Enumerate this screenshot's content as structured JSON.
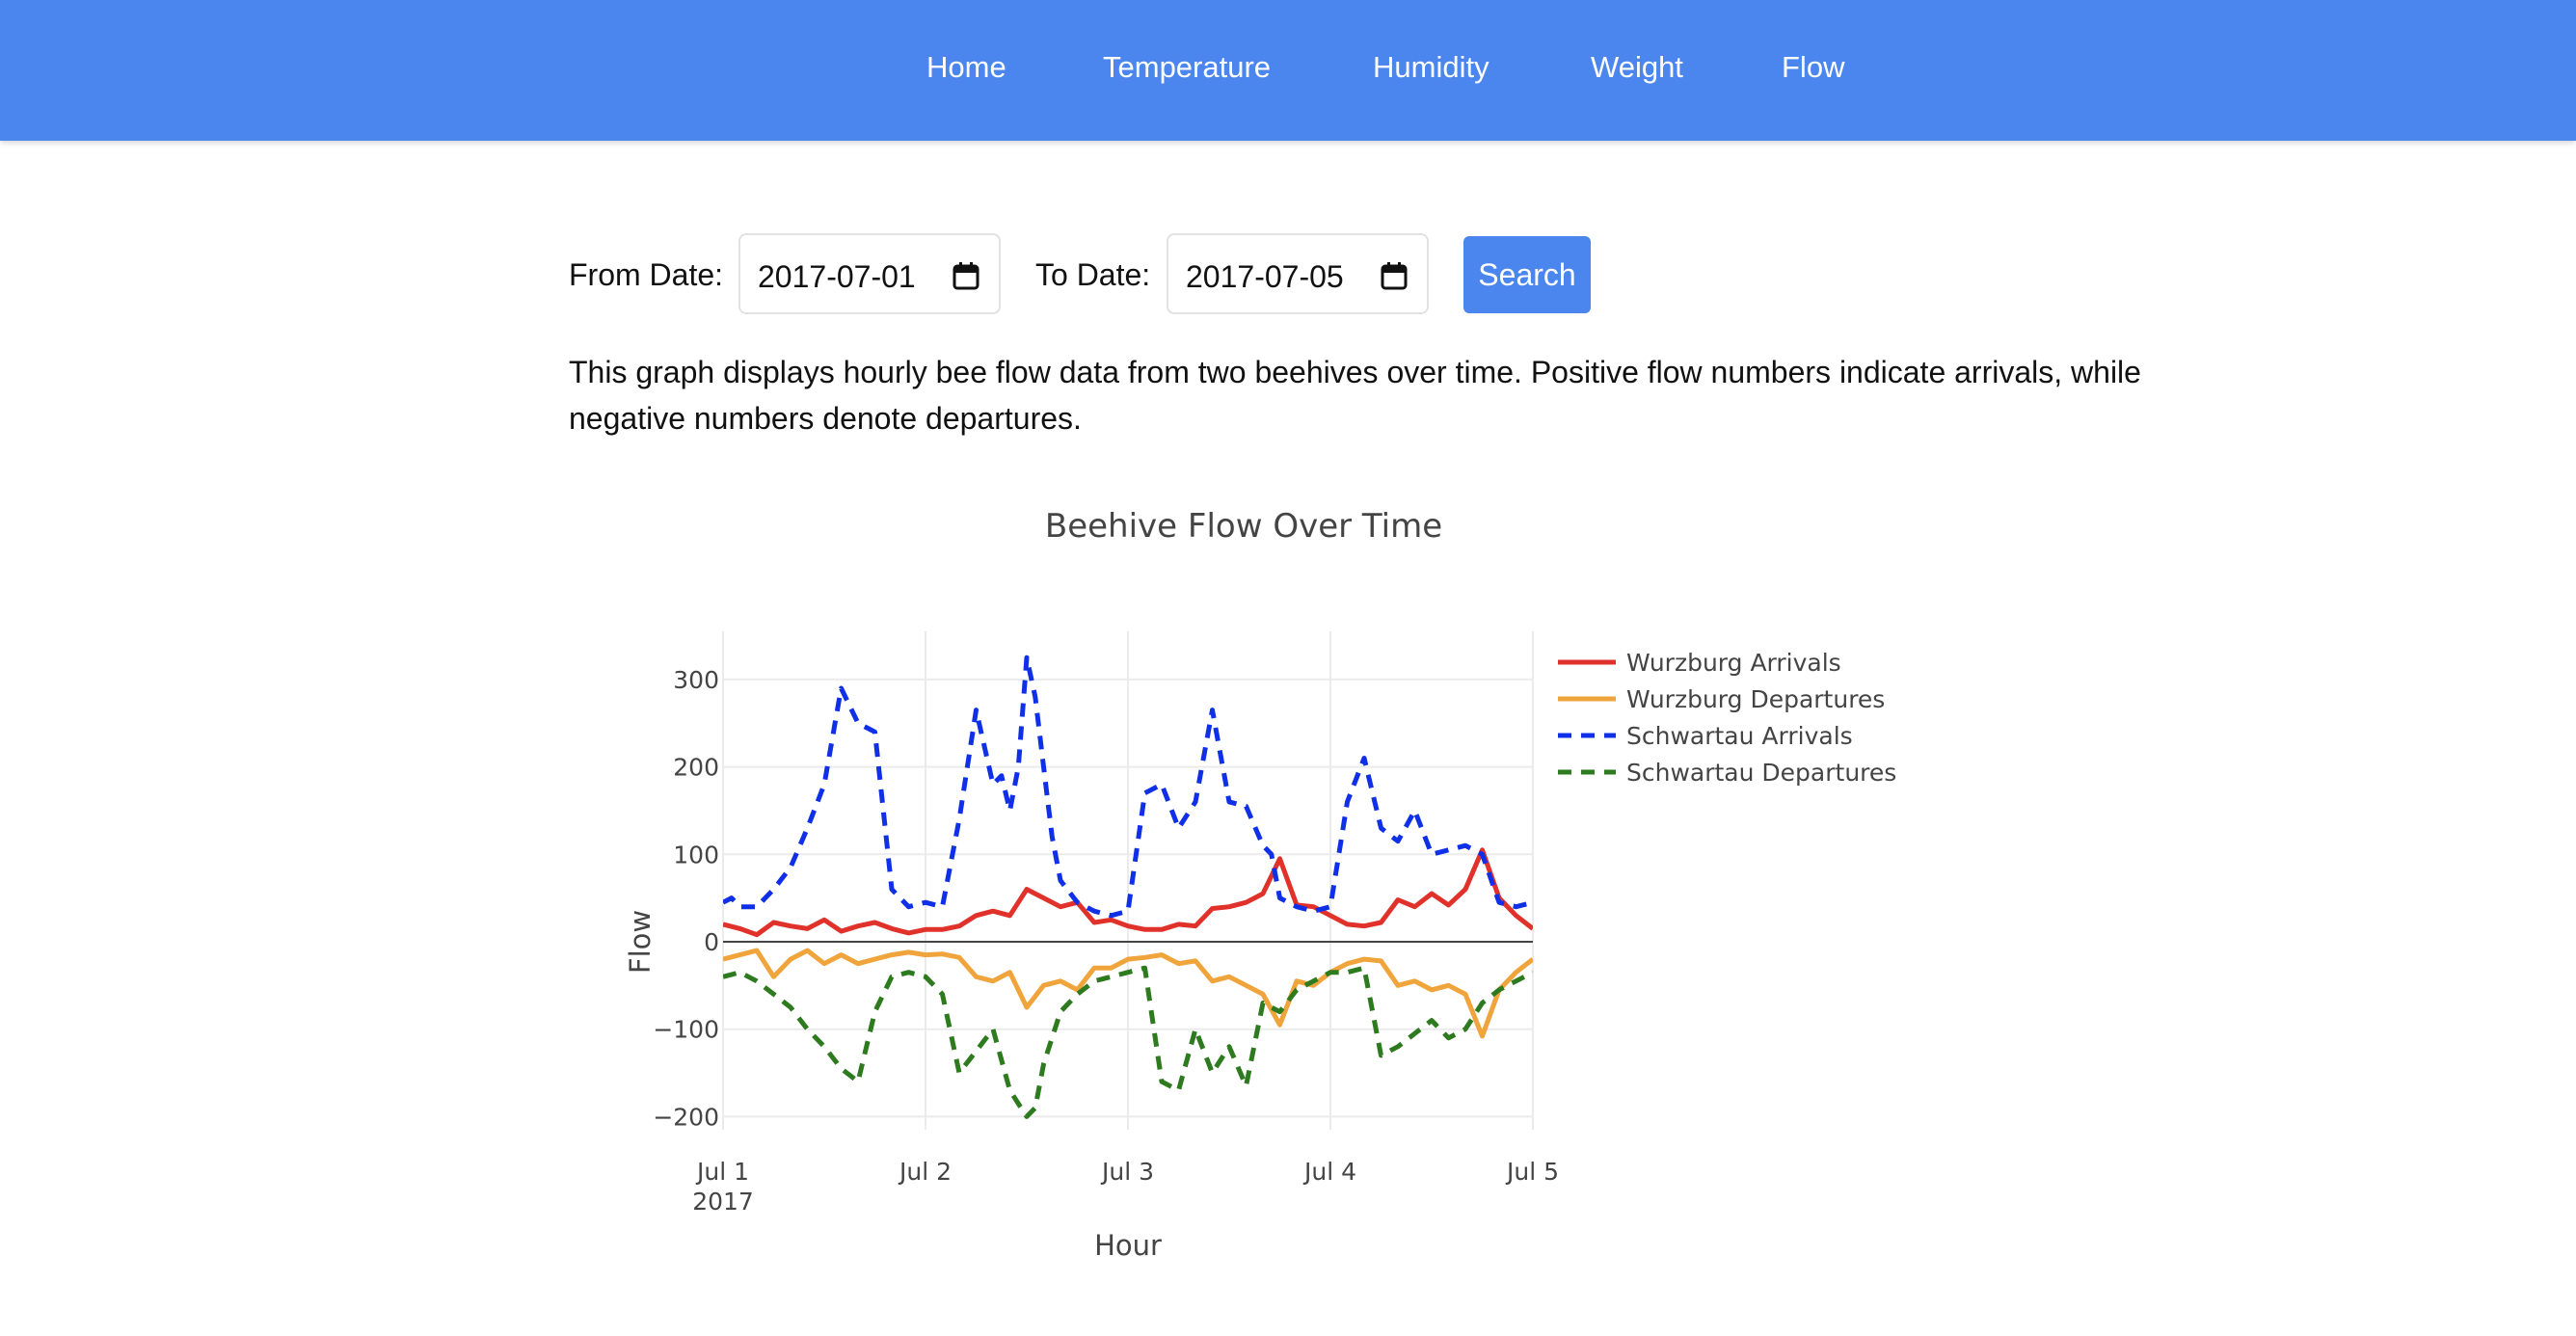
{
  "nav": {
    "items": [
      {
        "label": "Home"
      },
      {
        "label": "Temperature"
      },
      {
        "label": "Humidity"
      },
      {
        "label": "Weight"
      },
      {
        "label": "Flow"
      }
    ]
  },
  "filter": {
    "from_label": "From Date:",
    "from_value": "2017-07-01",
    "to_label": "To Date:",
    "to_value": "2017-07-05",
    "search_label": "Search"
  },
  "description": "This graph displays hourly bee flow data from two beehives over time. Positive flow numbers indicate arrivals, while negative numbers denote departures.",
  "chart_data": {
    "type": "line",
    "title": "Beehive Flow Over Time",
    "xlabel": "Hour",
    "ylabel": "Flow",
    "x_range": [
      "2017-07-01",
      "2017-07-05"
    ],
    "ylim": [
      -215,
      355
    ],
    "x_ticks": [
      {
        "value": "2017-07-01",
        "label": "Jul 1",
        "sublabel": "2017"
      },
      {
        "value": "2017-07-02",
        "label": "Jul 2",
        "sublabel": ""
      },
      {
        "value": "2017-07-03",
        "label": "Jul 3",
        "sublabel": ""
      },
      {
        "value": "2017-07-04",
        "label": "Jul 4",
        "sublabel": ""
      },
      {
        "value": "2017-07-05",
        "label": "Jul 5",
        "sublabel": ""
      }
    ],
    "y_ticks": [
      {
        "value": 300,
        "label": "300"
      },
      {
        "value": 200,
        "label": "200"
      },
      {
        "value": 100,
        "label": "100"
      },
      {
        "value": 0,
        "label": "0"
      },
      {
        "value": -100,
        "label": "−100"
      },
      {
        "value": -200,
        "label": "−200"
      }
    ],
    "grid": true,
    "legend_position": "top-right outside",
    "series": [
      {
        "name": "Wurzburg Arrivals",
        "color": "#e0322a",
        "dash": "solid",
        "x": [
          "2017-07-01 00:00",
          "2017-07-01 02:00",
          "2017-07-01 04:00",
          "2017-07-01 06:00",
          "2017-07-01 08:00",
          "2017-07-01 10:00",
          "2017-07-01 12:00",
          "2017-07-01 14:00",
          "2017-07-01 16:00",
          "2017-07-01 18:00",
          "2017-07-01 20:00",
          "2017-07-01 22:00",
          "2017-07-02 00:00",
          "2017-07-02 02:00",
          "2017-07-02 04:00",
          "2017-07-02 06:00",
          "2017-07-02 08:00",
          "2017-07-02 10:00",
          "2017-07-02 12:00",
          "2017-07-02 14:00",
          "2017-07-02 16:00",
          "2017-07-02 18:00",
          "2017-07-02 20:00",
          "2017-07-02 22:00",
          "2017-07-03 00:00",
          "2017-07-03 02:00",
          "2017-07-03 04:00",
          "2017-07-03 06:00",
          "2017-07-03 08:00",
          "2017-07-03 10:00",
          "2017-07-03 12:00",
          "2017-07-03 14:00",
          "2017-07-03 16:00",
          "2017-07-03 18:00",
          "2017-07-03 20:00",
          "2017-07-03 22:00",
          "2017-07-04 00:00",
          "2017-07-04 02:00",
          "2017-07-04 04:00",
          "2017-07-04 06:00",
          "2017-07-04 08:00",
          "2017-07-04 10:00",
          "2017-07-04 12:00",
          "2017-07-04 14:00",
          "2017-07-04 16:00",
          "2017-07-04 18:00",
          "2017-07-04 20:00",
          "2017-07-04 22:00",
          "2017-07-05 00:00"
        ],
        "y": [
          20,
          15,
          8,
          22,
          18,
          15,
          25,
          12,
          18,
          22,
          15,
          10,
          14,
          14,
          18,
          30,
          35,
          30,
          60,
          50,
          40,
          45,
          22,
          25,
          18,
          14,
          14,
          20,
          18,
          38,
          40,
          45,
          55,
          95,
          42,
          40,
          30,
          20,
          18,
          22,
          48,
          40,
          55,
          42,
          60,
          105,
          50,
          30,
          15
        ]
      },
      {
        "name": "Wurzburg Departures",
        "color": "#f0a43c",
        "dash": "solid",
        "x": [
          "2017-07-01 00:00",
          "2017-07-01 02:00",
          "2017-07-01 04:00",
          "2017-07-01 06:00",
          "2017-07-01 08:00",
          "2017-07-01 10:00",
          "2017-07-01 12:00",
          "2017-07-01 14:00",
          "2017-07-01 16:00",
          "2017-07-01 18:00",
          "2017-07-01 20:00",
          "2017-07-01 22:00",
          "2017-07-02 00:00",
          "2017-07-02 02:00",
          "2017-07-02 04:00",
          "2017-07-02 06:00",
          "2017-07-02 08:00",
          "2017-07-02 10:00",
          "2017-07-02 12:00",
          "2017-07-02 14:00",
          "2017-07-02 16:00",
          "2017-07-02 18:00",
          "2017-07-02 20:00",
          "2017-07-02 22:00",
          "2017-07-03 00:00",
          "2017-07-03 02:00",
          "2017-07-03 04:00",
          "2017-07-03 06:00",
          "2017-07-03 08:00",
          "2017-07-03 10:00",
          "2017-07-03 12:00",
          "2017-07-03 14:00",
          "2017-07-03 16:00",
          "2017-07-03 18:00",
          "2017-07-03 20:00",
          "2017-07-03 22:00",
          "2017-07-04 00:00",
          "2017-07-04 02:00",
          "2017-07-04 04:00",
          "2017-07-04 06:00",
          "2017-07-04 08:00",
          "2017-07-04 10:00",
          "2017-07-04 12:00",
          "2017-07-04 14:00",
          "2017-07-04 16:00",
          "2017-07-04 18:00",
          "2017-07-04 20:00",
          "2017-07-04 22:00",
          "2017-07-05 00:00"
        ],
        "y": [
          -20,
          -15,
          -10,
          -40,
          -20,
          -10,
          -25,
          -15,
          -25,
          -20,
          -15,
          -12,
          -15,
          -14,
          -18,
          -40,
          -45,
          -35,
          -75,
          -50,
          -45,
          -55,
          -30,
          -30,
          -20,
          -18,
          -15,
          -25,
          -22,
          -45,
          -40,
          -50,
          -60,
          -95,
          -45,
          -50,
          -35,
          -25,
          -20,
          -22,
          -50,
          -45,
          -55,
          -50,
          -60,
          -108,
          -55,
          -35,
          -20
        ]
      },
      {
        "name": "Schwartau Arrivals",
        "color": "#1030e8",
        "dash": "dash",
        "x": [
          "2017-07-01 00:00",
          "2017-07-01 01:00",
          "2017-07-01 02:00",
          "2017-07-01 04:00",
          "2017-07-01 06:00",
          "2017-07-01 08:00",
          "2017-07-01 10:00",
          "2017-07-01 12:00",
          "2017-07-01 14:00",
          "2017-07-01 16:00",
          "2017-07-01 18:00",
          "2017-07-01 20:00",
          "2017-07-01 22:00",
          "2017-07-02 00:00",
          "2017-07-02 02:00",
          "2017-07-02 04:00",
          "2017-07-02 06:00",
          "2017-07-02 08:00",
          "2017-07-02 09:00",
          "2017-07-02 10:00",
          "2017-07-02 11:00",
          "2017-07-02 12:00",
          "2017-07-02 13:00",
          "2017-07-02 14:00",
          "2017-07-02 15:00",
          "2017-07-02 16:00",
          "2017-07-02 18:00",
          "2017-07-02 20:00",
          "2017-07-02 22:00",
          "2017-07-03 00:00",
          "2017-07-03 02:00",
          "2017-07-03 04:00",
          "2017-07-03 06:00",
          "2017-07-03 08:00",
          "2017-07-03 10:00",
          "2017-07-03 12:00",
          "2017-07-03 14:00",
          "2017-07-03 16:00",
          "2017-07-03 17:00",
          "2017-07-03 18:00",
          "2017-07-03 20:00",
          "2017-07-03 22:00",
          "2017-07-04 00:00",
          "2017-07-04 02:00",
          "2017-07-04 04:00",
          "2017-07-04 06:00",
          "2017-07-04 08:00",
          "2017-07-04 10:00",
          "2017-07-04 12:00",
          "2017-07-04 14:00",
          "2017-07-04 16:00",
          "2017-07-04 18:00",
          "2017-07-04 20:00",
          "2017-07-04 22:00",
          "2017-07-05 00:00"
        ],
        "y": [
          45,
          50,
          40,
          40,
          60,
          85,
          130,
          180,
          290,
          250,
          240,
          60,
          40,
          45,
          40,
          140,
          265,
          180,
          190,
          150,
          200,
          325,
          280,
          200,
          120,
          70,
          45,
          35,
          30,
          35,
          170,
          180,
          130,
          160,
          265,
          160,
          155,
          110,
          100,
          50,
          40,
          35,
          40,
          160,
          210,
          130,
          115,
          150,
          100,
          105,
          110,
          100,
          45,
          40,
          45
        ]
      },
      {
        "name": "Schwartau Departures",
        "color": "#2e7a1e",
        "dash": "dash",
        "x": [
          "2017-07-01 00:00",
          "2017-07-01 02:00",
          "2017-07-01 04:00",
          "2017-07-01 06:00",
          "2017-07-01 08:00",
          "2017-07-01 10:00",
          "2017-07-01 12:00",
          "2017-07-01 14:00",
          "2017-07-01 16:00",
          "2017-07-01 18:00",
          "2017-07-01 20:00",
          "2017-07-01 22:00",
          "2017-07-02 00:00",
          "2017-07-02 02:00",
          "2017-07-02 04:00",
          "2017-07-02 06:00",
          "2017-07-02 08:00",
          "2017-07-02 10:00",
          "2017-07-02 12:00",
          "2017-07-02 13:00",
          "2017-07-02 14:00",
          "2017-07-02 16:00",
          "2017-07-02 18:00",
          "2017-07-02 20:00",
          "2017-07-02 22:00",
          "2017-07-03 00:00",
          "2017-07-03 02:00",
          "2017-07-03 04:00",
          "2017-07-03 06:00",
          "2017-07-03 08:00",
          "2017-07-03 10:00",
          "2017-07-03 12:00",
          "2017-07-03 14:00",
          "2017-07-03 16:00",
          "2017-07-03 18:00",
          "2017-07-03 20:00",
          "2017-07-03 22:00",
          "2017-07-04 00:00",
          "2017-07-04 02:00",
          "2017-07-04 04:00",
          "2017-07-04 06:00",
          "2017-07-04 08:00",
          "2017-07-04 10:00",
          "2017-07-04 12:00",
          "2017-07-04 14:00",
          "2017-07-04 16:00",
          "2017-07-04 18:00",
          "2017-07-04 20:00",
          "2017-07-04 22:00",
          "2017-07-05 00:00"
        ],
        "y": [
          -40,
          -35,
          -45,
          -60,
          -75,
          -100,
          -120,
          -145,
          -160,
          -80,
          -40,
          -35,
          -40,
          -60,
          -150,
          -125,
          -100,
          -170,
          -200,
          -190,
          -140,
          -80,
          -60,
          -45,
          -40,
          -35,
          -30,
          -160,
          -170,
          -100,
          -150,
          -120,
          -165,
          -70,
          -80,
          -55,
          -45,
          -35,
          -35,
          -30,
          -130,
          -120,
          -105,
          -90,
          -110,
          -100,
          -70,
          -55,
          -45,
          -35
        ]
      }
    ]
  }
}
